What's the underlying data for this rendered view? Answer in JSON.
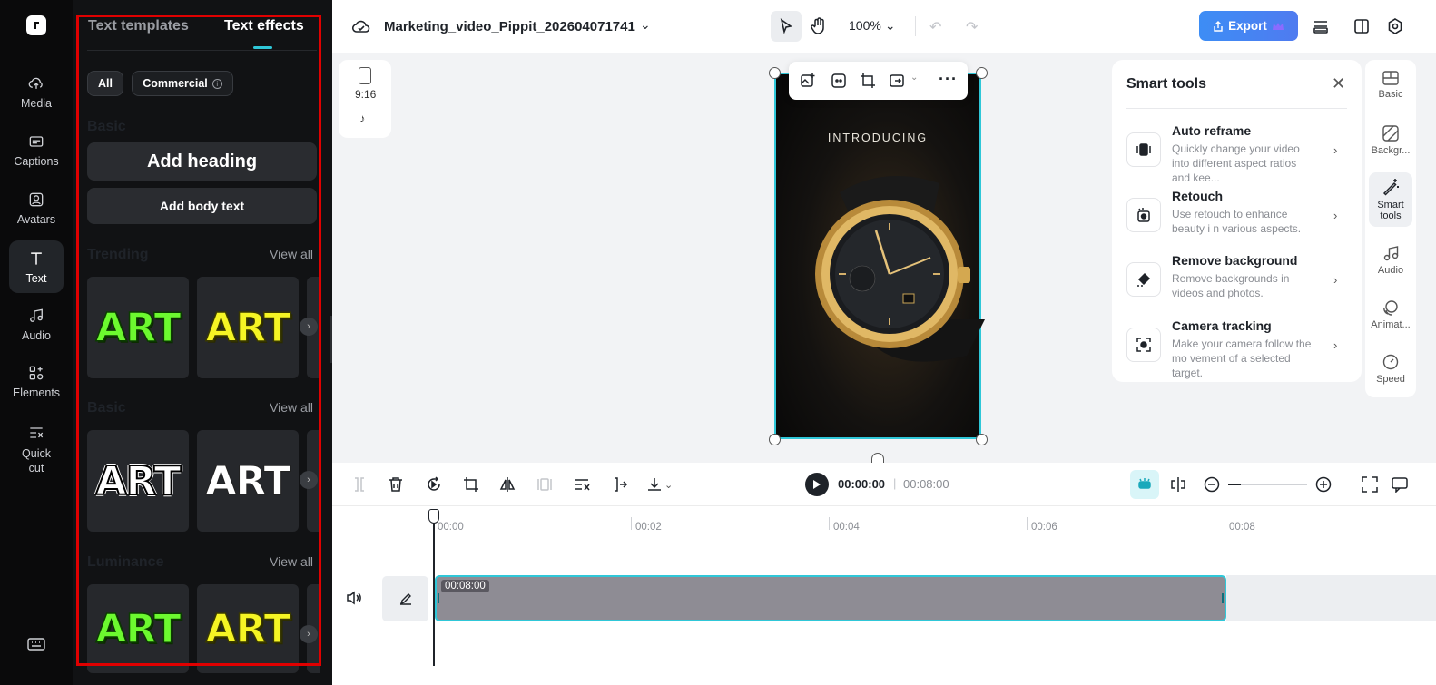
{
  "rail": {
    "items": [
      {
        "label": "Media",
        "icon": "cloud-upload-icon"
      },
      {
        "label": "Captions",
        "icon": "captions-icon"
      },
      {
        "label": "Avatars",
        "icon": "avatar-icon"
      },
      {
        "label": "Text",
        "icon": "text-icon"
      },
      {
        "label": "Audio",
        "icon": "music-note-icon"
      },
      {
        "label": "Elements",
        "icon": "elements-icon"
      },
      {
        "label": "Quick\ncut",
        "icon": "quick-cut-icon"
      }
    ],
    "active": "Text"
  },
  "panel": {
    "tabs": [
      "Text templates",
      "Text effects"
    ],
    "active_tab": "Text effects",
    "filters": {
      "all": "All",
      "commercial": "Commercial"
    },
    "basic_heading": "Basic",
    "add_heading": "Add heading",
    "add_body": "Add body text",
    "sections": [
      {
        "title": "Trending",
        "view_all": "View all",
        "cards": [
          "ART",
          "ART"
        ]
      },
      {
        "title": "Basic",
        "view_all": "View all",
        "cards": [
          "ART",
          "ART"
        ]
      },
      {
        "title": "Luminance",
        "view_all": "View all",
        "cards": [
          "ART",
          "ART"
        ]
      }
    ]
  },
  "topbar": {
    "project_name": "Marketing_video_Pippit_202604071741",
    "zoom": "100%",
    "export_label": "Export"
  },
  "canvas": {
    "ratio_label": "9:16",
    "video_text": "INTRODUCING"
  },
  "smart_tools": {
    "title": "Smart tools",
    "items": [
      {
        "title": "Auto reframe",
        "desc": "Quickly change your video into different aspect ratios and kee..."
      },
      {
        "title": "Retouch",
        "desc": "Use retouch to enhance beauty i n various aspects."
      },
      {
        "title": "Remove background",
        "desc": "Remove backgrounds in videos and photos."
      },
      {
        "title": "Camera tracking",
        "desc": "Make your camera follow the mo vement of a selected target."
      }
    ]
  },
  "right_rail": {
    "items": [
      "Basic",
      "Backgr...",
      "Smart tools",
      "Audio",
      "Animat...",
      "Speed"
    ],
    "active": "Smart tools"
  },
  "timeline": {
    "current_time": "00:00:00",
    "total_time": "00:08:00",
    "ticks": [
      "00:00",
      "00:02",
      "00:04",
      "00:06",
      "00:08"
    ],
    "clip_duration": "00:08:00"
  }
}
